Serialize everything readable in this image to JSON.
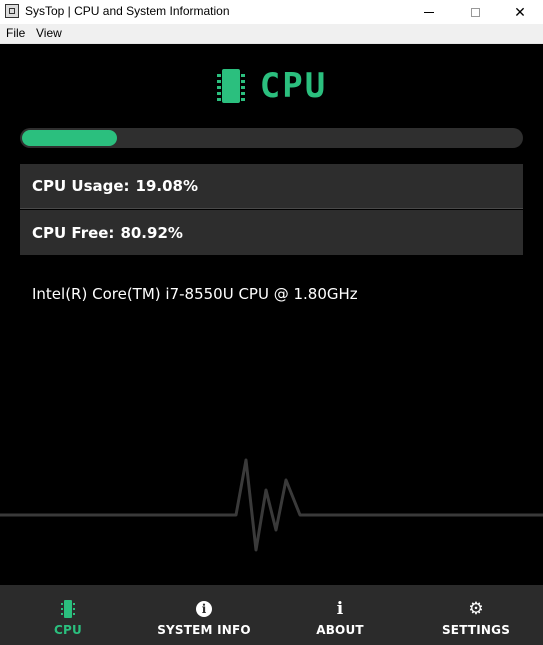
{
  "window": {
    "title": "SysTop | CPU and System Information",
    "minimize": "",
    "maximize": "",
    "close": "✕"
  },
  "menu": {
    "items": [
      "File",
      "View"
    ]
  },
  "header": {
    "title": "CPU",
    "icon": "cpu-chip-icon"
  },
  "progress": {
    "percent": 19.08
  },
  "stats": {
    "usage_label": "CPU Usage:",
    "usage_value": "19.08%",
    "free_label": "CPU Free:",
    "free_value": "80.92%"
  },
  "cpu_name": "Intel(R) Core(TM) i7-8550U CPU @ 1.80GHz",
  "nav": {
    "items": [
      {
        "label": "CPU",
        "icon": "cpu-chip-icon",
        "active": true
      },
      {
        "label": "SYSTEM INFO",
        "icon": "info-circle-icon",
        "active": false
      },
      {
        "label": "ABOUT",
        "icon": "info-icon",
        "active": false
      },
      {
        "label": "SETTINGS",
        "icon": "gear-icon",
        "active": false
      }
    ]
  },
  "colors": {
    "accent": "#2bbf7e",
    "background": "#000000",
    "panel": "#2d2d2d",
    "nav_background": "#2b2b2b",
    "text": "#ffffff"
  }
}
